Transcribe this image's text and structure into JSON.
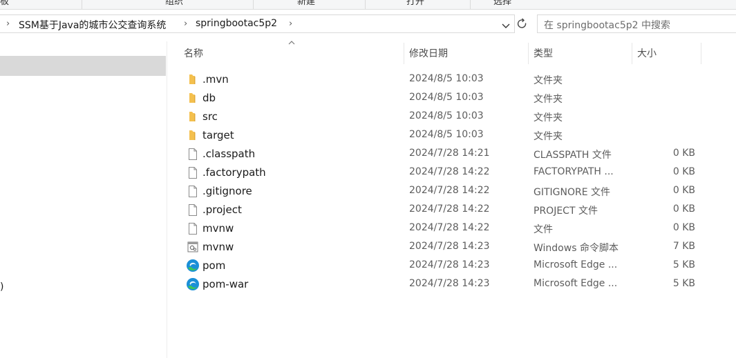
{
  "ribbon": {
    "groups": [
      "板",
      "组织",
      "新建",
      "打开",
      "选择"
    ]
  },
  "address": {
    "crumbs": [
      "SSM基于Java的城市公交查询系统",
      "springbootac5p2"
    ],
    "dropdown_icon": "chevron-down-icon",
    "refresh_icon": "refresh-icon"
  },
  "search": {
    "placeholder": "在 springbootac5p2 中搜索"
  },
  "nav": {
    "fragment_text": ")"
  },
  "columns": {
    "name": "名称",
    "date": "修改日期",
    "type": "类型",
    "size": "大小"
  },
  "files": [
    {
      "name": ".mvn",
      "date": "2024/8/5 10:03",
      "type": "文件夹",
      "size": "",
      "icon": "folder-icon"
    },
    {
      "name": "db",
      "date": "2024/8/5 10:03",
      "type": "文件夹",
      "size": "",
      "icon": "folder-icon"
    },
    {
      "name": "src",
      "date": "2024/8/5 10:03",
      "type": "文件夹",
      "size": "",
      "icon": "folder-icon"
    },
    {
      "name": "target",
      "date": "2024/8/5 10:03",
      "type": "文件夹",
      "size": "",
      "icon": "folder-icon"
    },
    {
      "name": ".classpath",
      "date": "2024/7/28 14:21",
      "type": "CLASSPATH 文件",
      "size": "0 KB",
      "icon": "file-icon"
    },
    {
      "name": ".factorypath",
      "date": "2024/7/28 14:22",
      "type": "FACTORYPATH ...",
      "size": "0 KB",
      "icon": "file-icon"
    },
    {
      "name": ".gitignore",
      "date": "2024/7/28 14:22",
      "type": "GITIGNORE 文件",
      "size": "0 KB",
      "icon": "file-icon"
    },
    {
      "name": ".project",
      "date": "2024/7/28 14:22",
      "type": "PROJECT 文件",
      "size": "0 KB",
      "icon": "file-icon"
    },
    {
      "name": "mvnw",
      "date": "2024/7/28 14:22",
      "type": "文件",
      "size": "0 KB",
      "icon": "file-icon"
    },
    {
      "name": "mvnw",
      "date": "2024/7/28 14:23",
      "type": "Windows 命令脚本",
      "size": "7 KB",
      "icon": "script-icon"
    },
    {
      "name": "pom",
      "date": "2024/7/28 14:23",
      "type": "Microsoft Edge ...",
      "size": "5 KB",
      "icon": "edge-icon"
    },
    {
      "name": "pom-war",
      "date": "2024/7/28 14:23",
      "type": "Microsoft Edge ...",
      "size": "5 KB",
      "icon": "edge-icon"
    }
  ]
}
